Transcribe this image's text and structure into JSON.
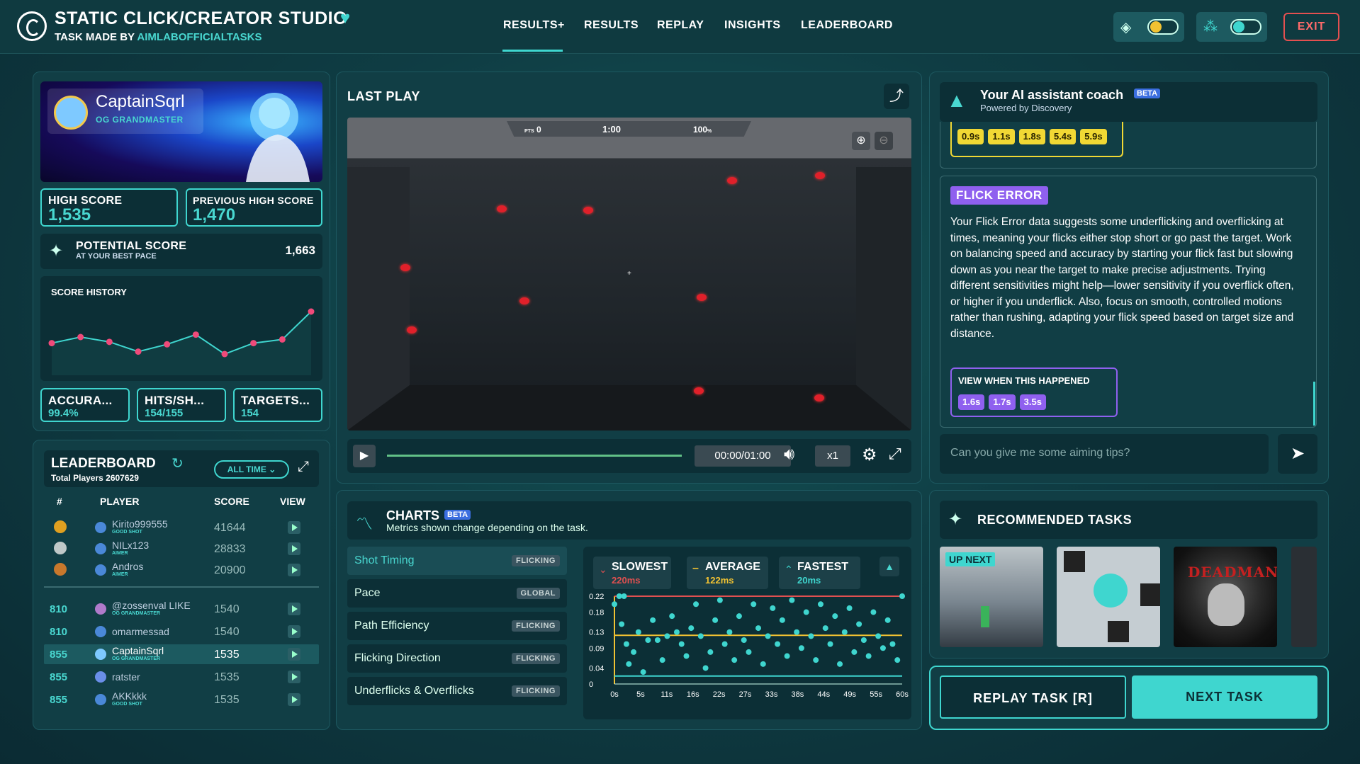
{
  "header": {
    "title": "STATIC CLICK/CREATOR STUDIO",
    "subtitle_prefix": "TASK MADE BY",
    "author": "AIMLABOFFICIALTASKS",
    "nav": [
      "RESULTS+",
      "RESULTS",
      "REPLAY",
      "INSIGHTS",
      "LEADERBOARD"
    ],
    "exit_label": "EXIT"
  },
  "profile": {
    "name": "CaptainSqrl",
    "rank": "OG GRANDMASTER",
    "high_score_label": "HIGH SCORE",
    "high_score": "1,535",
    "prev_high_label": "PREVIOUS HIGH SCORE",
    "prev_high": "1,470",
    "potential_label": "POTENTIAL SCORE",
    "potential_sub": "AT YOUR BEST PACE",
    "potential_value": "1,663",
    "score_history_label": "SCORE HISTORY",
    "score_history": [
      2,
      7,
      3,
      -5,
      1,
      9,
      -7,
      2,
      5,
      28
    ],
    "stats": [
      {
        "label": "ACCURA...",
        "value": "99.4%"
      },
      {
        "label": "HITS/SH...",
        "value": "154/155"
      },
      {
        "label": "TARGETS...",
        "value": "154"
      }
    ]
  },
  "leaderboard": {
    "title": "LEADERBOARD",
    "total_label": "Total Players",
    "total_value": "2607629",
    "filter": "ALL TIME",
    "columns": [
      "#",
      "PLAYER",
      "SCORE",
      "VIEW"
    ],
    "top": [
      {
        "name": "Kirito999555",
        "sub": "GOOD SHOT",
        "score": "41644",
        "medal": "#e0a020"
      },
      {
        "name": "NILx123",
        "sub": "AIMER",
        "score": "28833",
        "medal": "#c0c8c8"
      },
      {
        "name": "Andros",
        "sub": "AIMER",
        "score": "20900",
        "medal": "#c8782c"
      }
    ],
    "rows": [
      {
        "rank": "810",
        "name": "@zossenval LIKE",
        "sub": "OG GRANDMASTER",
        "score": "1540"
      },
      {
        "rank": "810",
        "name": "omarmessad",
        "sub": "",
        "score": "1540"
      },
      {
        "rank": "855",
        "name": "CaptainSqrl",
        "sub": "OG GRANDMASTER",
        "score": "1535"
      },
      {
        "rank": "855",
        "name": "ratster",
        "sub": "",
        "score": "1535"
      },
      {
        "rank": "855",
        "name": "AKKkkk",
        "sub": "GOOD SHOT",
        "score": "1535"
      }
    ]
  },
  "last_play": {
    "title": "LAST PLAY",
    "hud": {
      "pts_label": "PTS",
      "pts": "0",
      "time": "1:00",
      "acc": "100",
      "acc_unit": "%"
    },
    "time_display": "00:00/01:00",
    "speed": "x1"
  },
  "coach": {
    "title": "Your AI assistant coach",
    "beta": "BETA",
    "powered": "Powered by Discovery",
    "top_chips": [
      "0.9s",
      "1.1s",
      "1.8s",
      "5.4s",
      "5.9s"
    ],
    "error_title": "FLICK ERROR",
    "error_text": "Your Flick Error data suggests some underflicking and overflicking at times, meaning your flicks either stop short or go past the target. Work on balancing speed and accuracy by starting your flick fast but slowing down as you near the target to make precise adjustments. Trying different sensitivities might help—lower sensitivity if you overflick often, or higher if you underflick. Also, focus on smooth, controlled motions rather than rushing, adapting your flick speed based on target size and distance.",
    "view_when_label": "VIEW WHEN THIS HAPPENED",
    "view_chips": [
      "1.6s",
      "1.7s",
      "3.5s"
    ],
    "input_placeholder": "Can you give me some aiming tips?"
  },
  "charts": {
    "title": "CHARTS",
    "beta": "BETA",
    "subtitle": "Metrics shown change depending on the task.",
    "metrics": [
      {
        "label": "Shot Timing",
        "badge": "FLICKING"
      },
      {
        "label": "Pace",
        "badge": "GLOBAL"
      },
      {
        "label": "Path Efficiency",
        "badge": "FLICKING"
      },
      {
        "label": "Flicking Direction",
        "badge": "FLICKING"
      },
      {
        "label": "Underflicks & Overflicks",
        "badge": "FLICKING"
      }
    ],
    "summary": [
      {
        "label": "SLOWEST",
        "value": "220ms",
        "color": "#e05050"
      },
      {
        "label": "AVERAGE",
        "value": "122ms",
        "color": "#f1c232"
      },
      {
        "label": "FASTEST",
        "value": "20ms",
        "color": "#3fd6cf"
      }
    ]
  },
  "chart_data": {
    "type": "scatter",
    "xlabel": "",
    "ylabel": "",
    "x_ticks": [
      "0s",
      "5s",
      "11s",
      "16s",
      "22s",
      "27s",
      "33s",
      "38s",
      "44s",
      "49s",
      "55s",
      "60s"
    ],
    "y_ticks": [
      "0.22",
      "0.18",
      "0.13",
      "0.09",
      "0.04",
      "0"
    ],
    "xlim": [
      0,
      60
    ],
    "ylim": [
      0,
      0.22
    ],
    "reference_lines": [
      {
        "name": "SLOWEST",
        "y": 0.22
      },
      {
        "name": "AVERAGE",
        "y": 0.122
      },
      {
        "name": "FASTEST",
        "y": 0.02
      }
    ],
    "points": [
      [
        0,
        0.2
      ],
      [
        1,
        0.22
      ],
      [
        2,
        0.22
      ],
      [
        1.5,
        0.15
      ],
      [
        2.5,
        0.1
      ],
      [
        3,
        0.05
      ],
      [
        4,
        0.08
      ],
      [
        5,
        0.13
      ],
      [
        6,
        0.03
      ],
      [
        7,
        0.11
      ],
      [
        8,
        0.16
      ],
      [
        9,
        0.11
      ],
      [
        10,
        0.06
      ],
      [
        11,
        0.12
      ],
      [
        12,
        0.17
      ],
      [
        13,
        0.13
      ],
      [
        14,
        0.1
      ],
      [
        15,
        0.07
      ],
      [
        16,
        0.14
      ],
      [
        17,
        0.2
      ],
      [
        18,
        0.12
      ],
      [
        19,
        0.04
      ],
      [
        20,
        0.08
      ],
      [
        21,
        0.16
      ],
      [
        22,
        0.21
      ],
      [
        23,
        0.1
      ],
      [
        24,
        0.13
      ],
      [
        25,
        0.06
      ],
      [
        26,
        0.17
      ],
      [
        27,
        0.11
      ],
      [
        28,
        0.08
      ],
      [
        29,
        0.2
      ],
      [
        30,
        0.14
      ],
      [
        31,
        0.05
      ],
      [
        32,
        0.12
      ],
      [
        33,
        0.19
      ],
      [
        34,
        0.1
      ],
      [
        35,
        0.16
      ],
      [
        36,
        0.07
      ],
      [
        37,
        0.21
      ],
      [
        38,
        0.13
      ],
      [
        39,
        0.09
      ],
      [
        40,
        0.18
      ],
      [
        41,
        0.12
      ],
      [
        42,
        0.06
      ],
      [
        43,
        0.2
      ],
      [
        44,
        0.14
      ],
      [
        45,
        0.1
      ],
      [
        46,
        0.17
      ],
      [
        47,
        0.05
      ],
      [
        48,
        0.13
      ],
      [
        49,
        0.19
      ],
      [
        50,
        0.08
      ],
      [
        51,
        0.15
      ],
      [
        52,
        0.11
      ],
      [
        53,
        0.07
      ],
      [
        54,
        0.18
      ],
      [
        55,
        0.12
      ],
      [
        56,
        0.09
      ],
      [
        57,
        0.16
      ],
      [
        58,
        0.1
      ],
      [
        59,
        0.06
      ],
      [
        60,
        0.22
      ]
    ]
  },
  "recommended": {
    "title": "RECOMMENDED TASKS",
    "up_next": "UP NEXT",
    "deadman": "DEADMAN"
  },
  "actions": {
    "replay": "REPLAY TASK [R]",
    "next": "NEXT TASK"
  },
  "colors": {
    "accent": "#3fd6cf",
    "purple": "#8f60ef",
    "yellow": "#f1d834",
    "danger": "#e45050"
  }
}
